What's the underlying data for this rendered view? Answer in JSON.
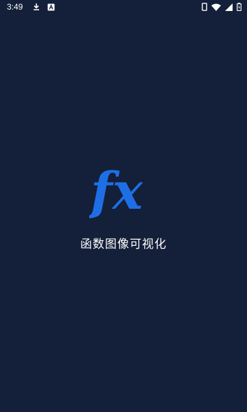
{
  "status_bar": {
    "time": "3:49",
    "left_icons": [
      "download-icon",
      "app-notification-icon"
    ],
    "right_icons": [
      "phone-icon",
      "wifi-icon",
      "signal-icon",
      "battery-icon"
    ]
  },
  "splash": {
    "logo_text": "fx",
    "app_name": "函数图像可视化"
  },
  "colors": {
    "background": "#141f39",
    "logo": "#1e6fe6",
    "text": "#ffffff"
  }
}
